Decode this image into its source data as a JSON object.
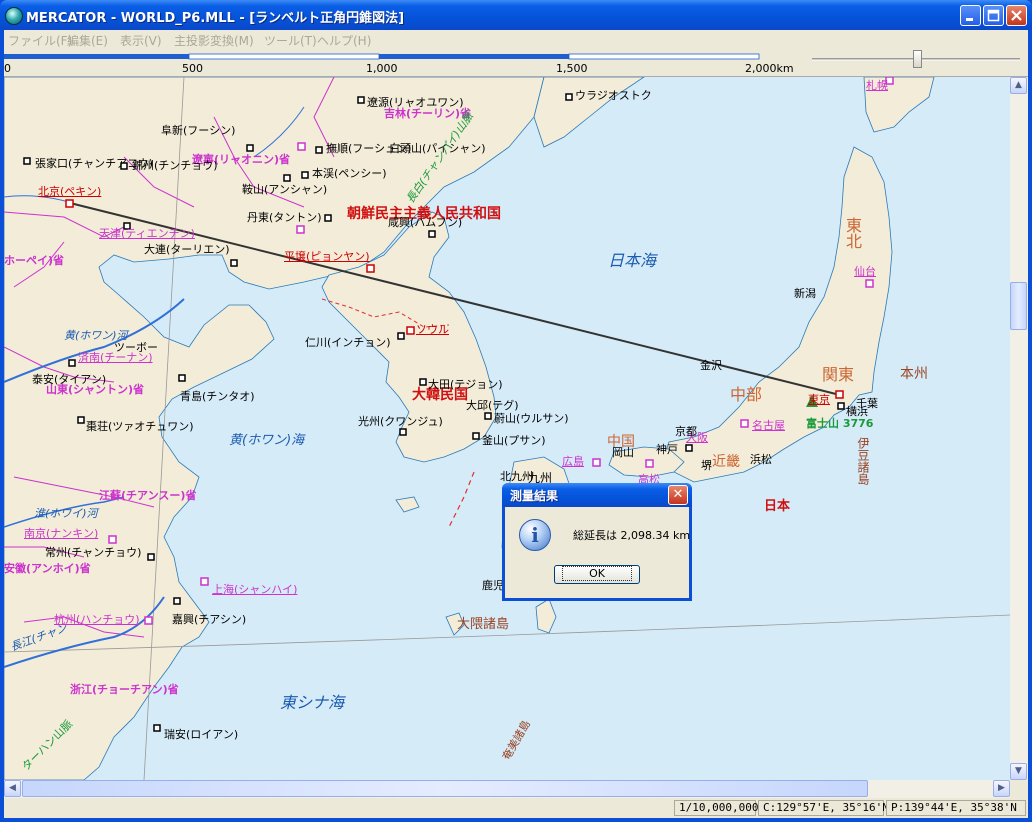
{
  "window": {
    "title": "MERCATOR - WORLD_P6.MLL - [ランベルト正角円錐図法]"
  },
  "menu": [
    "ファイル(F)",
    "編集(E)",
    "表示(V)",
    "主投影変換(M)",
    "ツール(T)",
    "ヘルプ(H)"
  ],
  "scale_bar": {
    "ticks": [
      "0",
      "500",
      "1,000",
      "1,500",
      "2,000km"
    ]
  },
  "map": {
    "regions": {
      "north_korea": "朝鮮民主主義人民共和国",
      "south_korea": "大韓民国",
      "japan": "日本",
      "japan_sea": "日本海",
      "yellow_sea": "黄(ホワン)海",
      "east_china_sea": "東シナ海",
      "osumi": "大隈諸島",
      "izu": "伊豆諸島",
      "amami": "奄美諸島",
      "honshu": "本州",
      "tohoku": "東北",
      "kanto": "関東",
      "chubu": "中部",
      "kinki": "近畿",
      "chugoku": "中国",
      "kyushu": "九州"
    },
    "provinces": {
      "jilin": "吉林(チーリン)省",
      "liaoning": "遼寧(リャオニン)省",
      "hebei": "ホーペイ)省",
      "shandong": "山東(シャントン)省",
      "jiangsu": "江蘇(チアンスー)省",
      "anhui": "安徽(アンホイ)省",
      "zhejiang": "浙江(チョーチアン)省"
    },
    "rivers": {
      "huang": "黄(ホワン)河",
      "huai": "淮(ホワイ)河",
      "changjiang": "長江(チャン"
    },
    "capitals": {
      "beijing": "北京(ペキン)",
      "tianjin": "天津(ティエンチン)",
      "pyongyang": "平壌(ピョンヤン)",
      "seoul": "ソウル",
      "jinan": "済南(チーナン)",
      "nanjing": "南京(ナンキン)",
      "shanghai": "上海(シャンハイ)",
      "hangzhou": "杭州(ハンチョウ)",
      "tokyo": "東京",
      "sapporo": "札幌",
      "sendai": "仙台",
      "nagoya": "名古屋",
      "osaka": "大阪",
      "hiroshima": "広島",
      "takamatsu": "高松"
    },
    "cities": {
      "zhangjiakou": "張家口(チャンチアコウ)",
      "fuxin": "阜新(フーシン)",
      "jinzhou": "錦州(チンチョウ)",
      "anshan": "鞍山(アンシャン)",
      "fushun": "撫順(フーシュン)",
      "benxi": "本渓(ペンシー)",
      "dandong": "丹東(タントン)",
      "dalian": "大連(ターリエン)",
      "liaoyuan": "遼源(リャオユワン)",
      "vladivostok": "ウラジオストク",
      "changbai": "白頭山(パイシャン)",
      "hamhung": "咸興(ハムフン)",
      "yantai": "ツーボー",
      "taian": "泰安(タイアン)",
      "qingdao": "青島(チンタオ)",
      "zaozhuang": "棗荘(ツァオチュワン)",
      "incheon": "仁川(インチョン)",
      "daejeon": "大田(テジョン)",
      "daegu": "大邱(テグ)",
      "ulsan": "蔚山(ウルサン)",
      "gwangju": "光州(クワンジュ)",
      "busan": "釜山(プサン)",
      "changzhou": "常州(チャンチョウ)",
      "jiaxing": "嘉興(チアシン)",
      "ruian": "瑞安(ロイアン)",
      "niigata": "新潟",
      "kanazawa": "金沢",
      "kyoto": "京都",
      "kobe": "神戸",
      "okayama": "岡山",
      "sakai": "堺",
      "hamamatsu": "浜松",
      "chiba": "千葉",
      "yokohama": "横浜",
      "kitakyushu": "北九州",
      "kagoshima": "鹿児"
    },
    "mountains": {
      "changbai_range": "長白(チャンパイ)山脈",
      "fuji": "富士山 3776",
      "taihang": "ターハン山脈"
    }
  },
  "dialog": {
    "title": "測量結果",
    "message": "総延長は 2,098.34 km",
    "ok_label": "OK"
  },
  "status": {
    "scale": "1/10,000,000",
    "center": "C:129°57'E, 35°16'N",
    "pointer": "P:139°44'E, 35°38'N"
  },
  "colors": {
    "water": "#d6ebf8",
    "land": "#f2ecd9",
    "border": "#cc33cc",
    "river": "#3070d8",
    "capital": "#cc0000",
    "region_label": "#cc6633"
  }
}
